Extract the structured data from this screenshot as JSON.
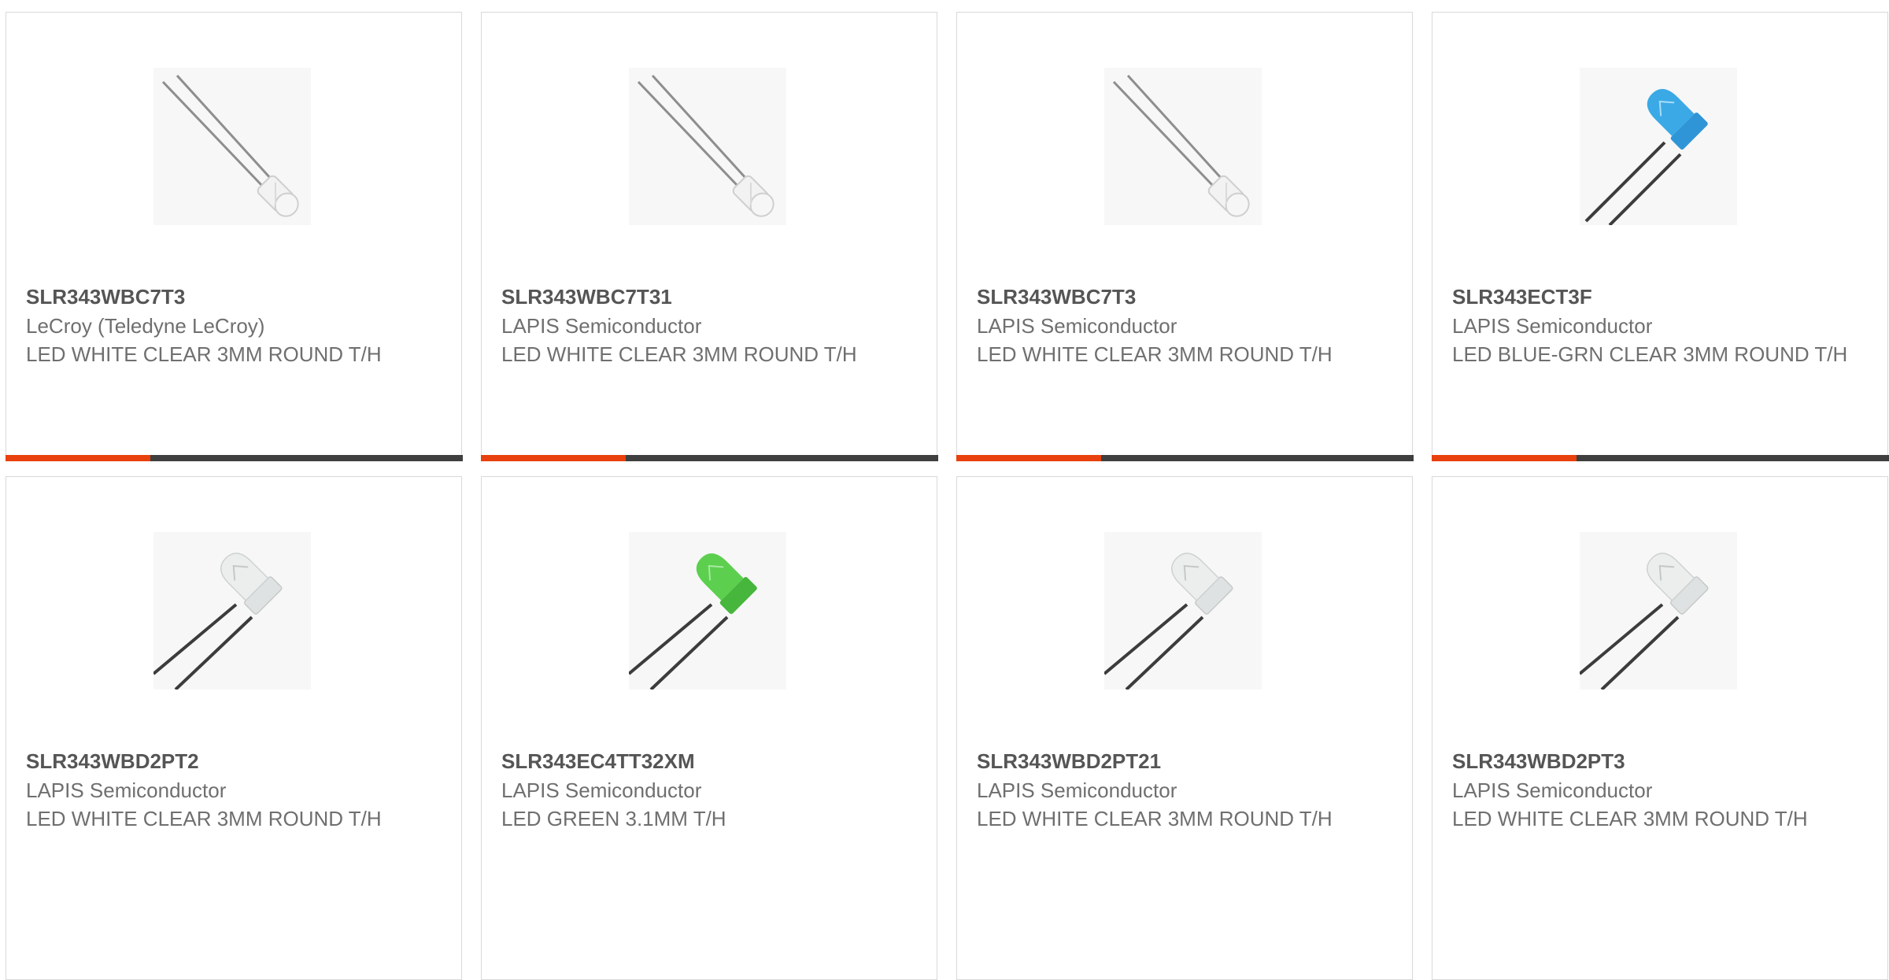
{
  "products": [
    {
      "part_number": "SLR343WBC7T3",
      "manufacturer": "LeCroy (Teledyne LeCroy)",
      "description": "LED WHITE CLEAR 3MM ROUND T/H",
      "image_icon": "led-side-clear-icon",
      "lens_color": "#eef0f0"
    },
    {
      "part_number": "SLR343WBC7T31",
      "manufacturer": "LAPIS Semiconductor",
      "description": "LED WHITE CLEAR 3MM ROUND T/H",
      "image_icon": "led-side-clear-icon",
      "lens_color": "#eef0f0"
    },
    {
      "part_number": "SLR343WBC7T3",
      "manufacturer": "LAPIS Semiconductor",
      "description": "LED WHITE CLEAR 3MM ROUND T/H",
      "image_icon": "led-side-clear-icon",
      "lens_color": "#eef0f0"
    },
    {
      "part_number": "SLR343ECT3F",
      "manufacturer": "LAPIS Semiconductor",
      "description": "LED BLUE-GRN CLEAR 3MM ROUND T/H",
      "image_icon": "led-blue-icon",
      "lens_color": "#3aa9e6"
    },
    {
      "part_number": "SLR343WBD2PT2",
      "manufacturer": "LAPIS Semiconductor",
      "description": "LED WHITE CLEAR 3MM ROUND T/H",
      "image_icon": "led-clear-icon",
      "lens_color": "#eceeee"
    },
    {
      "part_number": "SLR343EC4TT32XM",
      "manufacturer": "LAPIS Semiconductor",
      "description": "LED GREEN 3.1MM T/H",
      "image_icon": "led-green-icon",
      "lens_color": "#5ccf4f"
    },
    {
      "part_number": "SLR343WBD2PT21",
      "manufacturer": "LAPIS Semiconductor",
      "description": "LED WHITE CLEAR 3MM ROUND T/H",
      "image_icon": "led-clear-icon",
      "lens_color": "#eceeee"
    },
    {
      "part_number": "SLR343WBD2PT3",
      "manufacturer": "LAPIS Semiconductor",
      "description": "LED WHITE CLEAR 3MM ROUND T/H",
      "image_icon": "led-clear-icon",
      "lens_color": "#eceeee"
    }
  ],
  "colors": {
    "accent": "#e8410e",
    "bar": "#3f3f3f",
    "border": "#d9d9d9",
    "text": "#6f6f6f",
    "title": "#555555"
  }
}
